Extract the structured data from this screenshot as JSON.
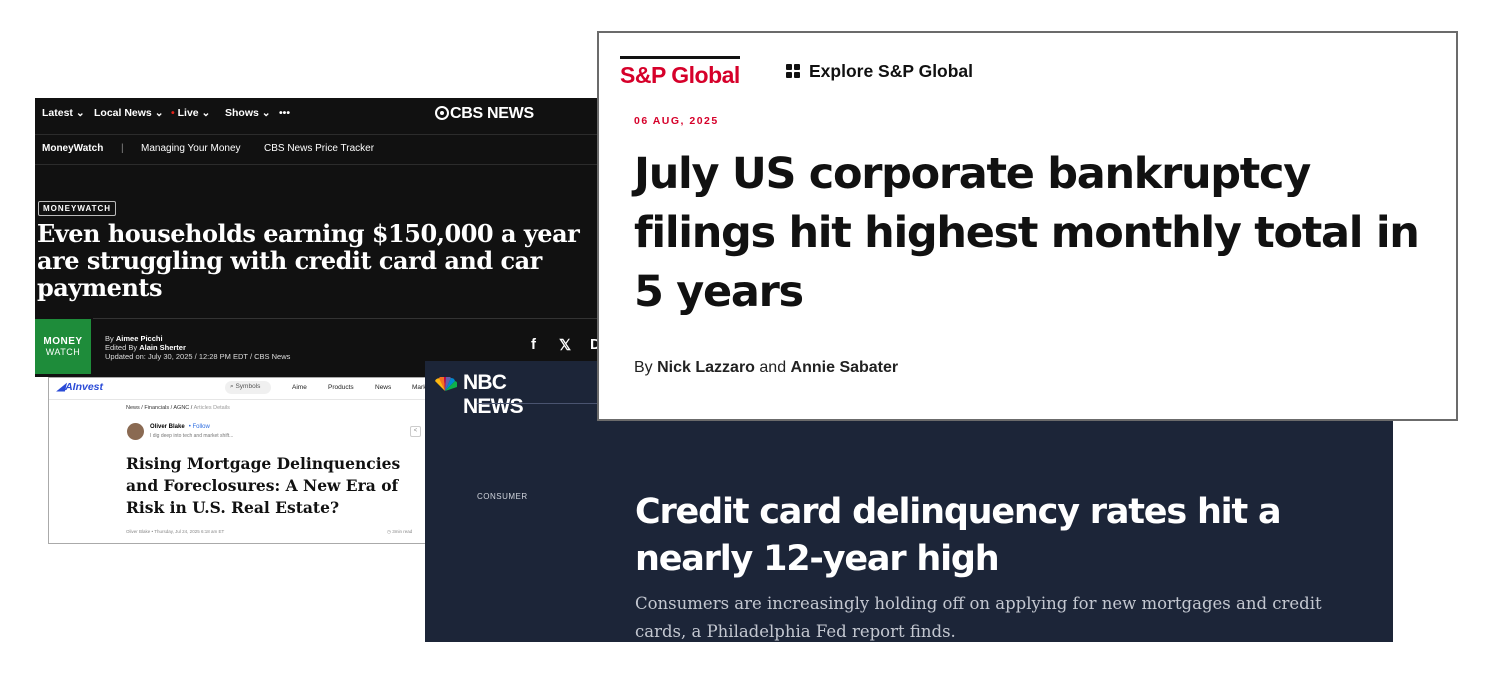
{
  "cbs": {
    "nav": [
      "Latest ⌄",
      "Local News ⌄",
      "Live ⌄",
      "Shows ⌄",
      "•••"
    ],
    "logo": "CBS NEWS",
    "subnav": [
      "MoneyWatch",
      "|",
      "Managing Your Money",
      "CBS News Price Tracker"
    ],
    "badge": "MONEYWATCH",
    "headline": "Even households earning $150,000 a year are struggling with credit card and car payments",
    "mw_logo_top": "MONEY",
    "mw_logo_bottom": "WATCH",
    "by_prefix": "By",
    "author": "Aimee Picchi",
    "edited_prefix": "Edited By",
    "editor": "Alain Sherter",
    "updated": "Updated on: July 30, 2025 / 12:28 PM EDT / CBS News",
    "share_icons": [
      "f",
      "𝕏",
      "D"
    ]
  },
  "ainvest": {
    "logo": "AInvest",
    "search_placeholder": "Symbols",
    "nav": [
      "Aime",
      "Products",
      "News",
      "Mark"
    ],
    "crumbs": "News / Financials / AGNC / ",
    "crumbs_current": "Articles Details",
    "author": "Oliver Blake",
    "follow": "Follow",
    "bio": "I dig deep into tech and market shift...",
    "title": "Rising Mortgage Delinquencies and Foreclosures: A New Era of Risk in U.S. Real Estate?",
    "footer": "Oliver Blake  •  Thursday, Jul 24, 2025 6:18 am ET",
    "read_time": "3min read"
  },
  "nbc": {
    "logo": "NBC NEWS",
    "section": "CONSUMER",
    "headline": "Credit card delinquency rates hit a nearly 12-year high",
    "dek": "Consumers are increasingly holding off on applying for new mortgages and credit cards, a Philadelphia Fed report finds."
  },
  "sp": {
    "logo": "S&P Global",
    "explore": "Explore S&P Global",
    "date": "06 AUG, 2025",
    "headline": "July US corporate bankruptcy filings hit highest monthly total in 5 years",
    "by_prefix": "By",
    "author1": "Nick Lazzaro",
    "and": "and",
    "author2": "Annie Sabater"
  },
  "colors": {
    "sp_red": "#d6002a",
    "cbs_bg": "#111111",
    "nbc_bg": "#1c2538",
    "moneywatch_green": "#1e8c3a",
    "ainvest_blue": "#2a4bd7"
  }
}
